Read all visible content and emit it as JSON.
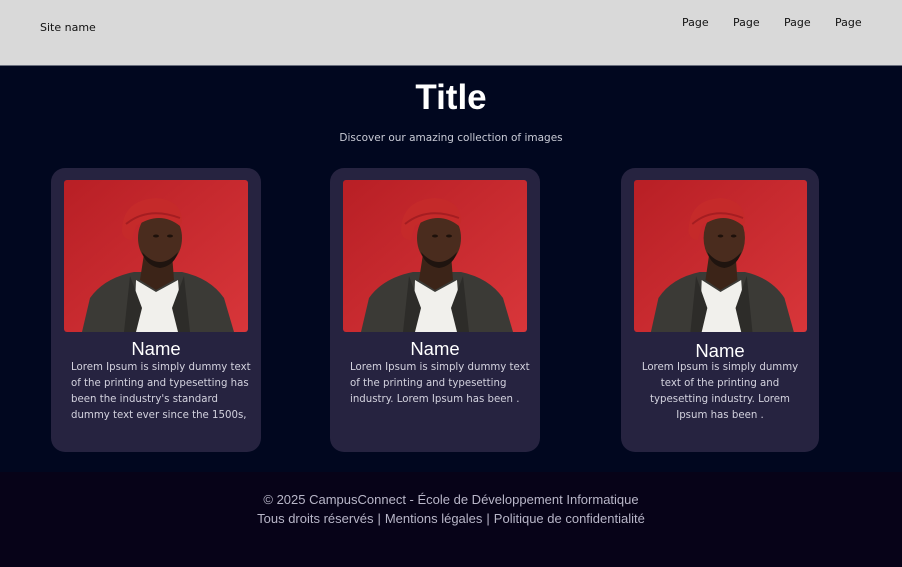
{
  "header": {
    "site_name": "Site name",
    "nav": [
      "Page",
      "Page",
      "Page",
      "Page"
    ]
  },
  "hero": {
    "title": "Title",
    "subtitle": "Discover our amazing collection of images"
  },
  "cards": [
    {
      "name": "Name",
      "text": "Lorem Ipsum is simply dummy text of the printing and typesetting has been the industry's standard dummy text ever since the 1500s,"
    },
    {
      "name": "Name",
      "text": "Lorem Ipsum is simply dummy text of the printing and typesetting industry. Lorem Ipsum has been ."
    },
    {
      "name": "Name",
      "text": "Lorem Ipsum is simply dummy text of the printing and typesetting industry. Lorem Ipsum has been ."
    }
  ],
  "footer": {
    "copyright": "© 2025 CampusConnect - École de Développement Informatique",
    "links": [
      "Tous droits réservés",
      "Mentions légales",
      "Politique de confidentialité"
    ],
    "separator": "|"
  },
  "colors": {
    "header_bg": "#d9d9d9",
    "page_bg": "#01071f",
    "card_bg": "#262340",
    "footer_bg": "#070318",
    "photo_bg": "#cf2a2e"
  }
}
